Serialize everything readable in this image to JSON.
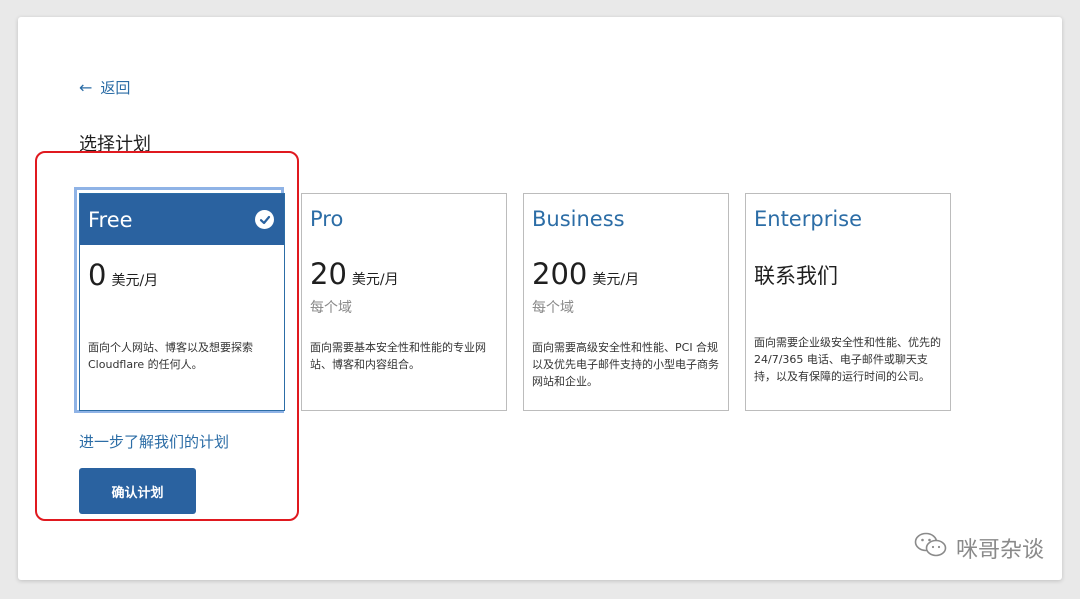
{
  "back": {
    "label": "返回"
  },
  "page_title": "选择计划",
  "plans": [
    {
      "name": "Free",
      "price": "0",
      "unit": "美元/月",
      "description": "面向个人网站、博客以及想要探索 Cloudflare 的任何人。",
      "selected": true
    },
    {
      "name": "Pro",
      "price": "20",
      "unit": "美元/月",
      "per_domain": "每个域",
      "description": "面向需要基本安全性和性能的专业网站、博客和内容组合。"
    },
    {
      "name": "Business",
      "price": "200",
      "unit": "美元/月",
      "per_domain": "每个域",
      "description": "面向需要高级安全性和性能、PCI 合规以及优先电子邮件支持的小型电子商务网站和企业。"
    },
    {
      "name": "Enterprise",
      "contact": "联系我们",
      "description": "面向需要企业级安全性和性能、优先的 24/7/365 电话、电子邮件或聊天支持，以及有保障的运行时间的公司。"
    }
  ],
  "learn_more": "进一步了解我们的计划",
  "confirm_button": "确认计划",
  "watermark": "咪哥杂谈",
  "colors": {
    "accent": "#2a62a0",
    "link": "#2c6da6",
    "highlight": "#e0191f"
  }
}
